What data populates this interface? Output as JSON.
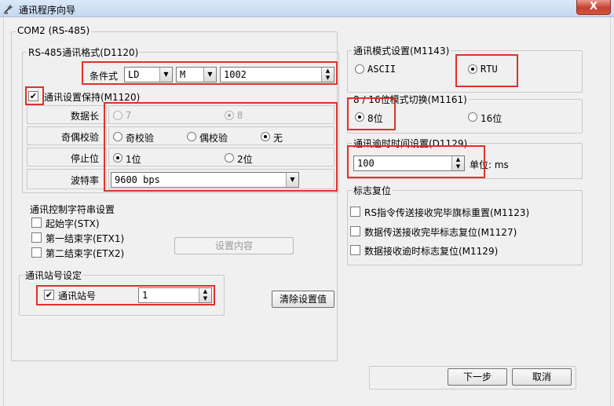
{
  "window": {
    "title": "通讯程序向导",
    "close_glyph": "X"
  },
  "port_group": {
    "title": "COM2 (RS-485)"
  },
  "format_group": {
    "title": "RS-485通讯格式(D1120)",
    "condition_label": "条件式",
    "condition_op": "LD",
    "condition_device": "M",
    "condition_number": "1002",
    "hold_label": "通讯设置保持(M1120)",
    "hold_checked": true,
    "data_length": {
      "label": "数据长",
      "options": [
        "7",
        "8"
      ],
      "selected": "8",
      "disabled": true
    },
    "parity": {
      "label": "奇偶校验",
      "options": [
        "奇校验",
        "偶校验",
        "无"
      ],
      "selected": "无"
    },
    "stop_bit": {
      "label": "停止位",
      "options": [
        "1位",
        "2位"
      ],
      "selected": "1位"
    },
    "baud_rate": {
      "label": "波特率",
      "value": "9600 bps"
    }
  },
  "control_chars": {
    "title": "通讯控制字符串设置",
    "items": [
      {
        "label": "起始字(STX)",
        "checked": false
      },
      {
        "label": "第一结束字(ETX1)",
        "checked": false
      },
      {
        "label": "第二结束字(ETX2)",
        "checked": false
      }
    ],
    "set_content_button": "设置内容"
  },
  "station_group": {
    "title": "通讯站号设定",
    "label": "通讯站号",
    "checked": true,
    "value": "1"
  },
  "clear_button": "清除设置值",
  "mode_group": {
    "title": "通讯模式设置(M1143)",
    "options": [
      "ASCII",
      "RTU"
    ],
    "selected": "RTU"
  },
  "bit_mode_group": {
    "title": "8 / 16位模式切换(M1161)",
    "options": [
      "8位",
      "16位"
    ],
    "selected": "8位"
  },
  "timeout_group": {
    "title": "通讯逾时时间设置(D1129)",
    "value": "100",
    "unit": "单位: ms"
  },
  "flag_reset_group": {
    "title": "标志复位",
    "items": [
      {
        "label": "RS指令传送接收完毕旗标重置(M1123)",
        "checked": false
      },
      {
        "label": "数据传送接收完毕标志复位(M1127)",
        "checked": false
      },
      {
        "label": "数据接收逾时标志复位(M1129)",
        "checked": false
      }
    ]
  },
  "footer": {
    "next_button": "下一步",
    "cancel_button": "取消"
  },
  "colors": {
    "highlight": "#e0302a",
    "background": "#f0f0f0"
  },
  "icons": [
    "wizard-app-icon",
    "dropdown-arrow-icon",
    "spin-arrows-icon",
    "check-icon"
  ]
}
